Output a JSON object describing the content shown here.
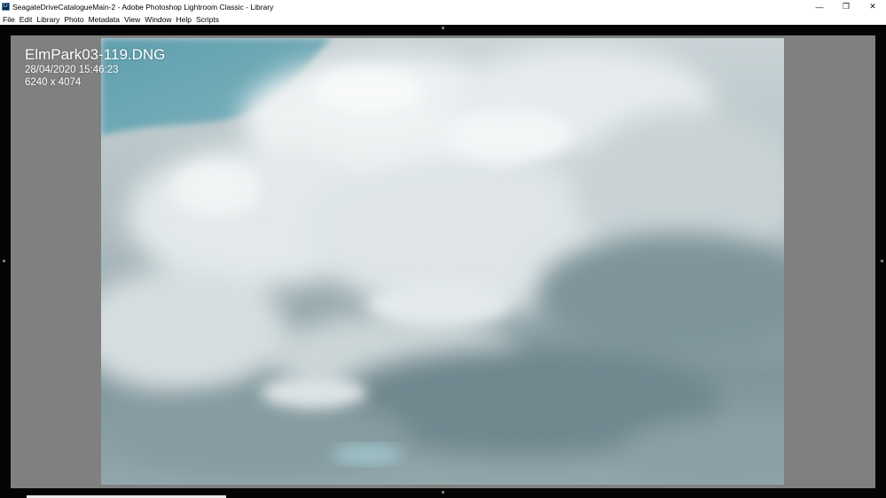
{
  "window": {
    "title": "SeagateDriveCatalogueMain-2 - Adobe Photoshop Lightroom Classic - Library",
    "app_icon_label": "Lr",
    "minimize_glyph": "—",
    "restore_glyph": "❐",
    "close_glyph": "✕"
  },
  "menubar": {
    "items": [
      "File",
      "Edit",
      "Library",
      "Photo",
      "Metadata",
      "View",
      "Window",
      "Help",
      "Scripts"
    ]
  },
  "photo_info": {
    "filename": "ElmPark03-119.DNG",
    "capture_time": "28/04/2020 15:46:23",
    "dimensions": "6240 x 4074"
  },
  "colors": {
    "sky_blue": "#6fa7b3",
    "cloud_white": "#e9eef0",
    "cloud_grey": "#7d9297",
    "loupe_background": "#808080"
  }
}
